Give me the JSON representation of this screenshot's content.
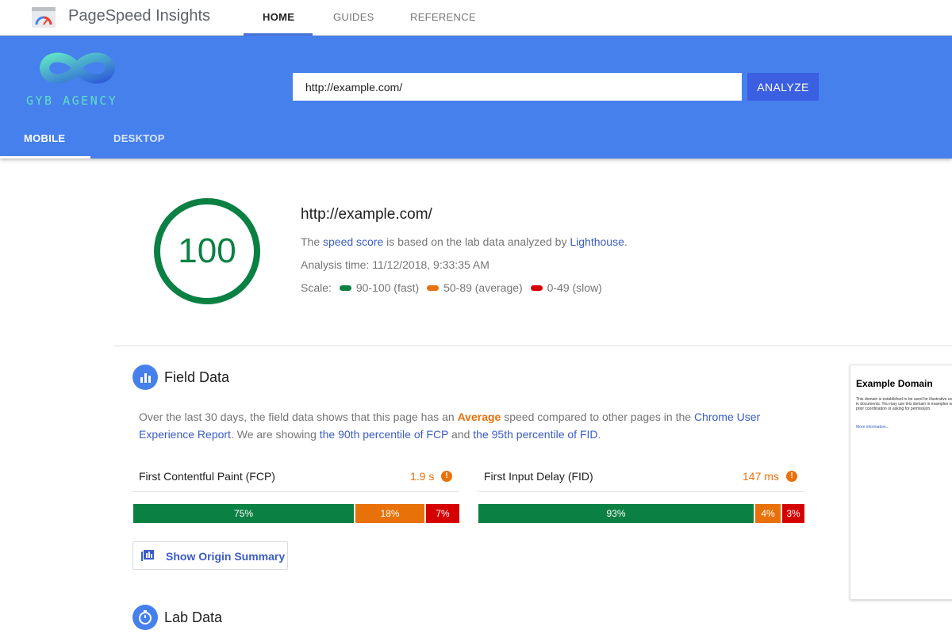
{
  "app": {
    "title": "PageSpeed Insights",
    "nav_tabs": [
      "HOME",
      "GUIDES",
      "REFERENCE"
    ],
    "active_tab": "HOME"
  },
  "header": {
    "agency_name": "GYB AGENCY",
    "url_input_value": "http://example.com/",
    "analyze_label": "ANALYZE",
    "mode_tabs": [
      "MOBILE",
      "DESKTOP"
    ],
    "active_mode": "MOBILE"
  },
  "score": {
    "value": "100",
    "value_fraction": 1.0,
    "url": "http://example.com/",
    "speed_text_pre": "The ",
    "speed_link": "speed score",
    "speed_text_mid": " is based on the lab data analyzed by ",
    "lighthouse_link": "Lighthouse",
    "speed_text_post": ".",
    "analysis_time": "Analysis time: 11/12/2018, 9:33:35 AM",
    "scale_label": "Scale:",
    "scale": [
      {
        "label": "90-100 (fast)",
        "color": "#0b8043"
      },
      {
        "label": "50-89 (average)",
        "color": "#e8710a"
      },
      {
        "label": "0-49 (slow)",
        "color": "#d50000"
      }
    ]
  },
  "field_data": {
    "title": "Field Data",
    "icon": "bar-chart-icon",
    "desc_1": "Over the last 30 days, the field data shows that this page has an ",
    "desc_avg": "Average",
    "desc_2": " speed compared to other pages in the ",
    "desc_link_crux": "Chrome User Experience Report",
    "desc_3": ". We are showing ",
    "desc_link_fcp": "the 90th percentile of FCP",
    "desc_4": " and ",
    "desc_link_fid": "the 95th percentile of FID",
    "desc_5": ".",
    "metrics": [
      {
        "name": "First Contentful Paint (FCP)",
        "value": "1.9 s",
        "fast": "75%",
        "average": "18%",
        "slow": "7%",
        "fast_pct": 75,
        "avg_pct": 18,
        "slow_pct": 7
      },
      {
        "name": "First Input Delay (FID)",
        "value": "147 ms",
        "fast": "93%",
        "average": "4%",
        "slow": "3%",
        "fast_pct": 93,
        "avg_pct": 4,
        "slow_pct": 3
      }
    ],
    "origin_button": "Show Origin Summary"
  },
  "lab_data": {
    "title": "Lab Data",
    "icon": "stopwatch-icon"
  },
  "screenshot": {
    "title": "Example Domain",
    "text": "This domain is established to be used for illustrative examples in documents. You may use this domain in examples without prior coordination or asking for permission.",
    "link": "More information..."
  },
  "colors": {
    "brand_blue": "#4680ec",
    "fast": "#0b8043",
    "average": "#e8710a",
    "slow": "#d50000",
    "link": "#3b5cc4"
  }
}
